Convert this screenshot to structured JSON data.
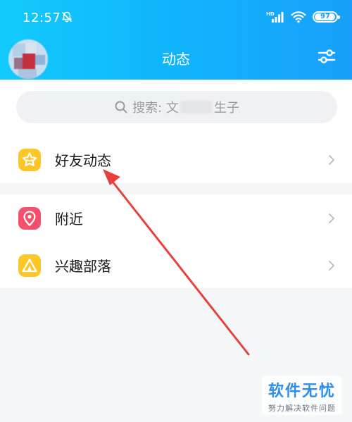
{
  "status_bar": {
    "time": "12:57",
    "network_badge": "HD",
    "battery_level": "97",
    "battery_fraction": 0.97,
    "icons": [
      "bell-muted-icon",
      "hd-signal-icon",
      "wifi-icon",
      "battery-icon"
    ]
  },
  "header": {
    "title": "动态",
    "right_icon": "filter-sliders-icon"
  },
  "search": {
    "prefix": "搜索: 文",
    "suffix": "生子",
    "icon": "search-icon"
  },
  "sections": [
    {
      "items": [
        {
          "label": "好友动态",
          "icon": "star-icon",
          "icon_color": "#fdc627"
        }
      ]
    },
    {
      "items": [
        {
          "label": "附近",
          "icon": "location-pin-icon",
          "icon_color": "#f5506b"
        },
        {
          "label": "兴趣部落",
          "icon": "tent-icon",
          "icon_color": "#fdc627"
        }
      ]
    }
  ],
  "annotation_color": "#e8403b",
  "watermark": {
    "main": "软件无忧",
    "sub": "努力解决软件问题"
  },
  "colors": {
    "header_start": "#12cafc",
    "header_end": "#199ffb",
    "background": "#f5f6f8"
  }
}
